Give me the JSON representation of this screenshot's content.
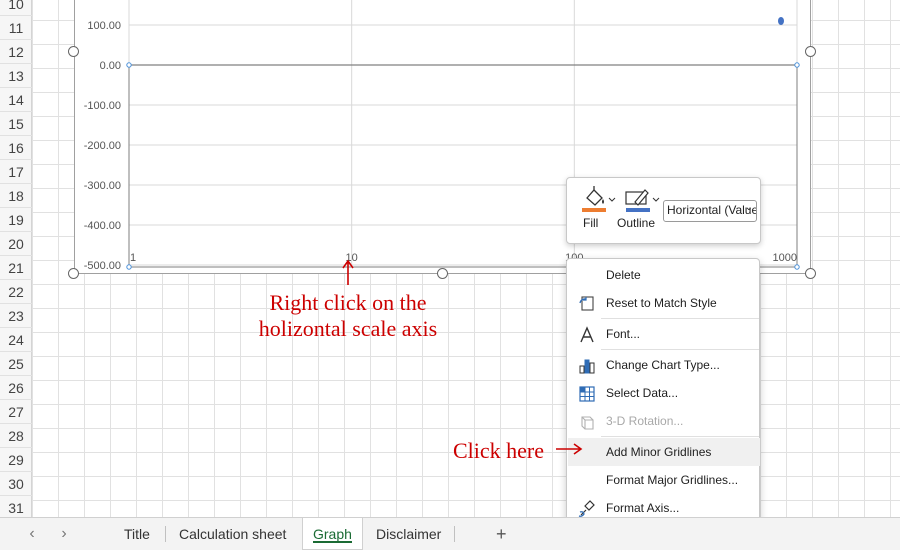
{
  "row_headers": [
    "10",
    "11",
    "12",
    "13",
    "14",
    "15",
    "16",
    "17",
    "18",
    "19",
    "20",
    "21",
    "22",
    "23",
    "24",
    "25",
    "26",
    "27",
    "28",
    "29",
    "30",
    "31"
  ],
  "chart_data": {
    "type": "scatter",
    "x_scale": "log",
    "xlim": [
      1,
      1000
    ],
    "ylim": [
      -500,
      100
    ],
    "y_ticks": [
      "100.00",
      "0.00",
      "-100.00",
      "-200.00",
      "-300.00",
      "-400.00",
      "-500.00"
    ],
    "x_ticks": [
      "1",
      "10",
      "100",
      "1000"
    ],
    "series": [
      {
        "values": [
          {
            "x": 1000,
            "y": 110
          }
        ],
        "color": "#4472c4"
      }
    ]
  },
  "mini_toolbar": {
    "fill_label": "Fill",
    "outline_label": "Outline",
    "element_select": "Horizontal (Value) Axis",
    "fill_color": "#ed7d31",
    "outline_color": "#4472c4"
  },
  "context_menu": {
    "items": [
      {
        "label": "Delete",
        "icon": "none",
        "disabled": false
      },
      {
        "label": "Reset to Match Style",
        "icon": "reset-style-icon",
        "disabled": false
      },
      {
        "label": "Font...",
        "icon": "font-icon",
        "disabled": false
      },
      {
        "label": "Change Chart Type...",
        "icon": "change-chart-type-icon",
        "disabled": false
      },
      {
        "label": "Select Data...",
        "icon": "select-data-icon",
        "disabled": false
      },
      {
        "label": "3-D Rotation...",
        "icon": "3d-rotation-icon",
        "disabled": true
      },
      {
        "label": "Add Minor Gridlines",
        "icon": "none",
        "disabled": false
      },
      {
        "label": "Format Major Gridlines...",
        "icon": "none",
        "disabled": false
      },
      {
        "label": "Format Axis...",
        "icon": "format-axis-icon",
        "disabled": false
      }
    ]
  },
  "annotations": {
    "axis_note_line1": "Right click on the",
    "axis_note_line2": "holizontal scale axis",
    "click_here": "Click here",
    "color": "#cc0000"
  },
  "sheet_tabs": {
    "tabs": [
      "Title",
      "Calculation sheet",
      "Graph",
      "Disclaimer"
    ],
    "active": "Graph",
    "add_label": "+"
  }
}
